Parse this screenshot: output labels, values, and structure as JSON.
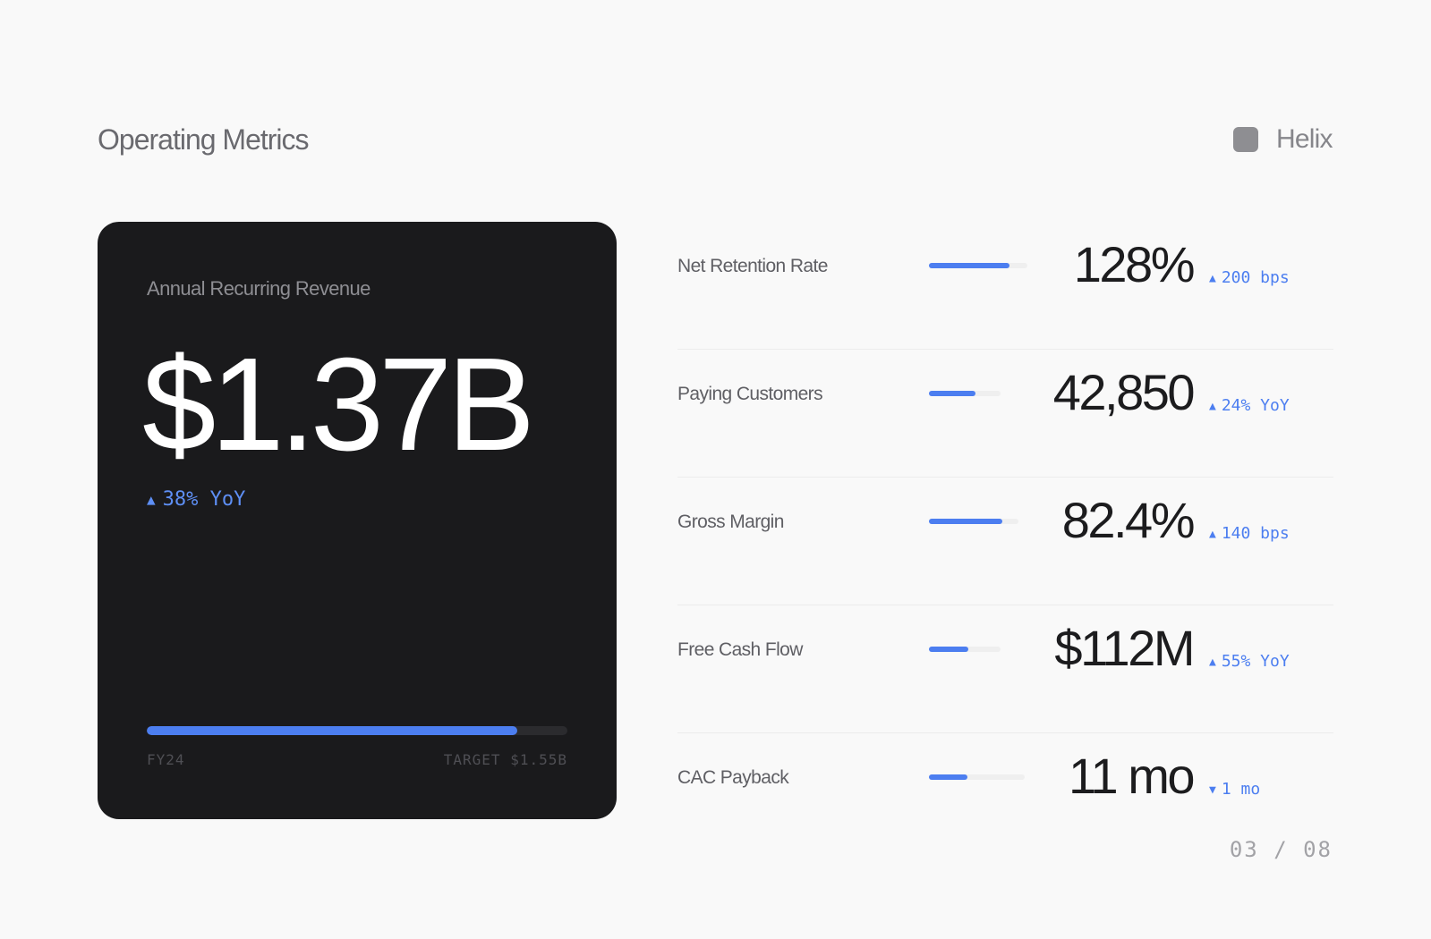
{
  "page": {
    "title": "Operating Metrics",
    "brand": "Helix",
    "page_number": "03 / 08"
  },
  "hero": {
    "label": "Annual Recurring Revenue",
    "value": "$1.37B",
    "delta_arrow": "▲",
    "delta": "38% YoY",
    "progress_fraction": 0.88,
    "foot_left": "FY24",
    "foot_right": "TARGET $1.55B",
    "accent_color": "#4c7ef0"
  },
  "metrics": [
    {
      "label": "Net Retention Rate",
      "value": "128%",
      "delta_arrow": "▲",
      "delta": "200 bps",
      "bar_fill": 0.82
    },
    {
      "label": "Paying Customers",
      "value": "42,850",
      "delta_arrow": "▲",
      "delta": "24% YoY",
      "bar_fill": 0.65
    },
    {
      "label": "Gross Margin",
      "value": "82.4%",
      "delta_arrow": "▲",
      "delta": "140 bps",
      "bar_fill": 0.82
    },
    {
      "label": "Free Cash Flow",
      "value": "$112M",
      "delta_arrow": "▲",
      "delta": "55% YoY",
      "bar_fill": 0.55
    },
    {
      "label": "CAC Payback",
      "value": "11 mo",
      "delta_arrow": "▼",
      "delta": "1 mo",
      "bar_fill": 0.4
    }
  ]
}
